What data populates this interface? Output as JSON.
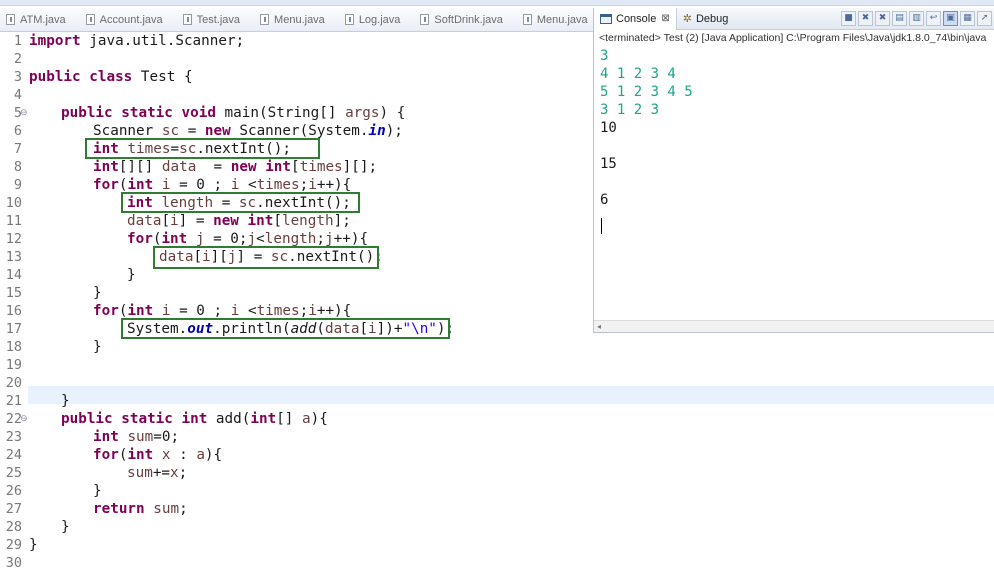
{
  "editor_tabs": [
    "ATM.java",
    "Account.java",
    "Test.java",
    "Menu.java",
    "Log.java",
    "SoftDrink.java",
    "Menu.java"
  ],
  "console": {
    "tabs": {
      "console_label": "Console",
      "debug_label": "Debug",
      "close_glyph": "⊠"
    },
    "status": "<terminated> Test (2) [Java Application] C:\\Program Files\\Java\\jdk1.8.0_74\\bin\\java",
    "input_lines": [
      "3",
      "4 1 2 3 4",
      "5 1 2 3 4 5",
      "3 1 2 3"
    ],
    "output_lines": [
      "10",
      "15",
      "6"
    ]
  },
  "code": {
    "line_numbers": [
      "1",
      "2",
      "3",
      "4",
      "5",
      "6",
      "7",
      "8",
      "9",
      "10",
      "11",
      "12",
      "13",
      "14",
      "15",
      "16",
      "17",
      "18",
      "19",
      "20",
      "21",
      "22",
      "23",
      "24",
      "25",
      "26",
      "27",
      "28",
      "29",
      "30"
    ],
    "l1_kw": "import",
    "l1_rest": " java.util.Scanner;",
    "l3_kw": "public class",
    "l3_rest": " Test {",
    "l5_kw1": "public static void",
    "l5_rest": " main(String[] ",
    "l5_var": "args",
    "l5_end": ") {",
    "l6_a": "Scanner ",
    "l6_var": "sc",
    "l6_b": " = ",
    "l6_kw": "new",
    "l6_c": " Scanner(System.",
    "l6_fld": "in",
    "l6_d": ");",
    "l7_kw": "int",
    "l7_sp": " ",
    "l7_var": "times",
    "l7_a": "=",
    "l7_var2": "sc",
    "l7_b": ".nextInt();",
    "l8_kw": "int",
    "l8_a": "[][] ",
    "l8_var": "data",
    "l8_b": "  = ",
    "l8_kw2": "new",
    "l8_sp": " ",
    "l8_kw3": "int",
    "l8_c": "[",
    "l8_var2": "times",
    "l8_d": "][];",
    "l9_kw": "for",
    "l9_a": "(",
    "l9_kw2": "int",
    "l9_sp": " ",
    "l9_var": "i",
    "l9_b": " = 0 ; ",
    "l9_var2": "i",
    "l9_c": " <",
    "l9_var3": "times",
    "l9_d": ";",
    "l9_var4": "i",
    "l9_e": "++){",
    "l10_kw": "int",
    "l10_sp": " ",
    "l10_var": "length",
    "l10_a": " = ",
    "l10_var2": "sc",
    "l10_b": ".nextInt();",
    "l11_var": "data",
    "l11_a": "[",
    "l11_var2": "i",
    "l11_b": "] = ",
    "l11_kw": "new",
    "l11_sp": " ",
    "l11_kw2": "int",
    "l11_c": "[",
    "l11_var3": "length",
    "l11_d": "];",
    "l12_kw": "for",
    "l12_a": "(",
    "l12_kw2": "int",
    "l12_sp": " ",
    "l12_var": "j",
    "l12_b": " = 0;",
    "l12_var2": "j",
    "l12_c": "<",
    "l12_var3": "length",
    "l12_d": ";",
    "l12_var4": "j",
    "l12_e": "++){",
    "l13_var": "data",
    "l13_a": "[",
    "l13_var2": "i",
    "l13_b": "][",
    "l13_var3": "j",
    "l13_c": "] = ",
    "l13_var4": "sc",
    "l13_d": ".nextInt();",
    "l14": "}",
    "l15": "}",
    "l16_kw": "for",
    "l16_a": "(",
    "l16_kw2": "int",
    "l16_sp": " ",
    "l16_var": "i",
    "l16_b": " = 0 ; ",
    "l16_var2": "i",
    "l16_c": " <",
    "l16_var3": "times",
    "l16_d": ";",
    "l16_var4": "i",
    "l16_e": "++){",
    "l17_a": "System.",
    "l17_fld": "out",
    "l17_b": ".println(",
    "l17_it": "add",
    "l17_c": "(",
    "l17_var": "data",
    "l17_d": "[",
    "l17_var2": "i",
    "l17_e": "])+",
    "l17_str": "\"\\n\"",
    "l17_f": ");",
    "l18": "}",
    "l21": "}",
    "l22_kw": "public static int",
    "l22_a": " add(",
    "l22_kw2": "int",
    "l22_b": "[] ",
    "l22_var": "a",
    "l22_c": "){",
    "l23_kw": "int",
    "l23_sp": " ",
    "l23_var": "sum",
    "l23_a": "=0;",
    "l24_kw": "for",
    "l24_a": "(",
    "l24_kw2": "int",
    "l24_sp": " ",
    "l24_var": "x",
    "l24_b": " : ",
    "l24_var2": "a",
    "l24_c": "){",
    "l25_var": "sum",
    "l25_a": "+=",
    "l25_var2": "x",
    "l25_b": ";",
    "l26": "}",
    "l27_kw": "return",
    "l27_sp": " ",
    "l27_var": "sum",
    "l27_a": ";",
    "l28": "}",
    "l29": "}"
  }
}
